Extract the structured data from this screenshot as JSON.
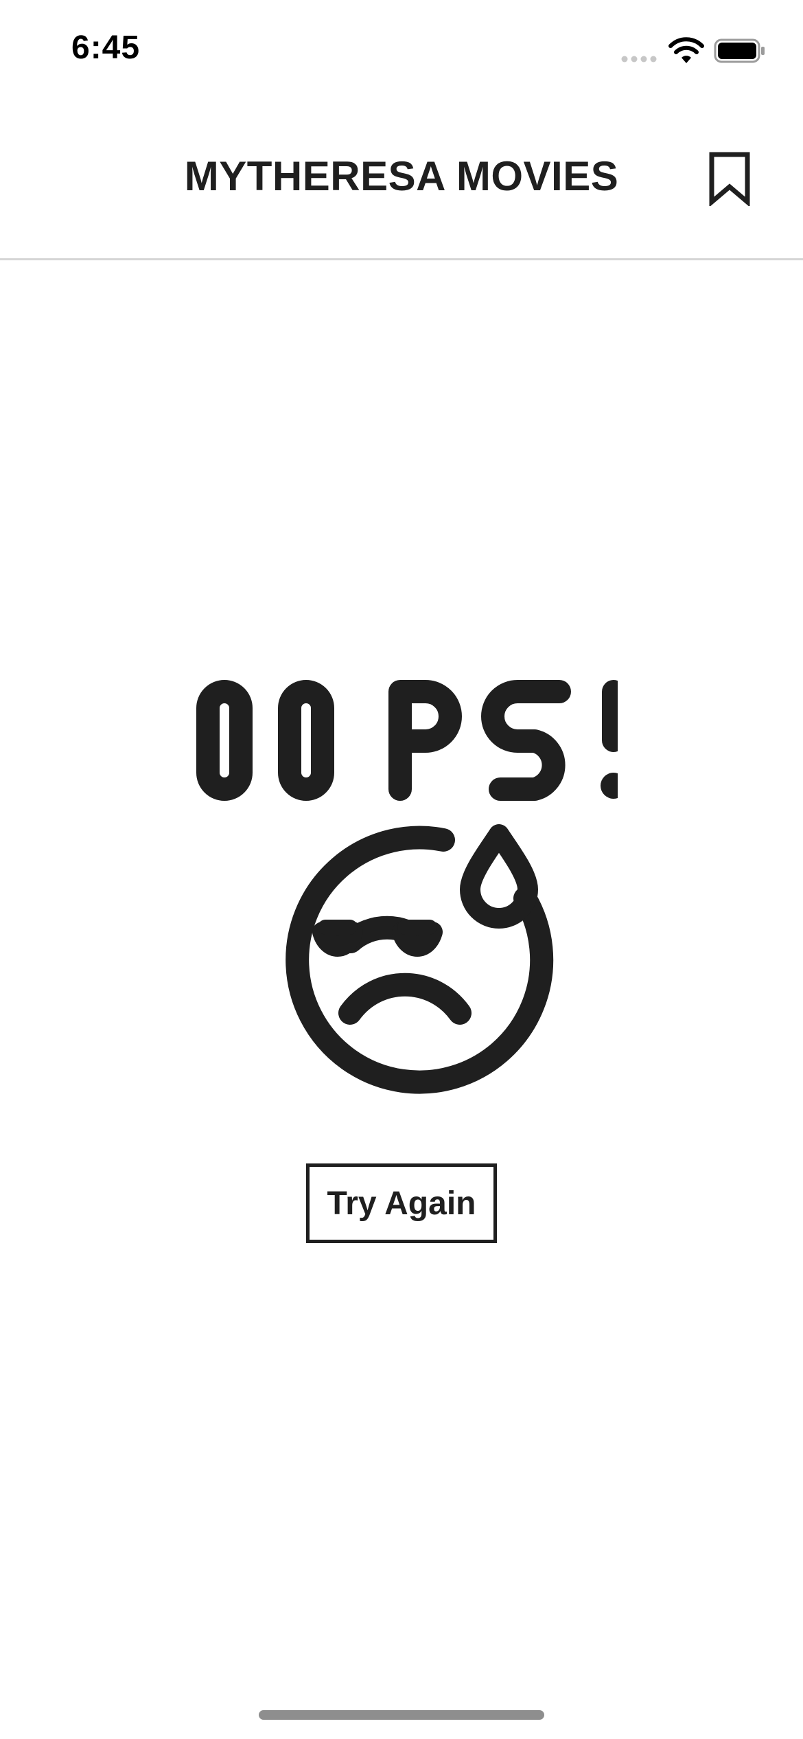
{
  "status_bar": {
    "time": "6:45",
    "signal_icon": "cellular-signal-icon",
    "wifi_icon": "wifi-icon",
    "battery_icon": "battery-icon"
  },
  "nav": {
    "title": "MYTHERESA MOVIES",
    "bookmark_icon": "bookmark-icon"
  },
  "error": {
    "heading": "OOPS!",
    "illustration_icon": "sad-sweating-face-icon",
    "retry_label": "Try Again"
  },
  "colors": {
    "text": "#1f1f1f",
    "divider": "#d6d6d6",
    "background": "#ffffff",
    "home_indicator": "#8e8e8e"
  }
}
